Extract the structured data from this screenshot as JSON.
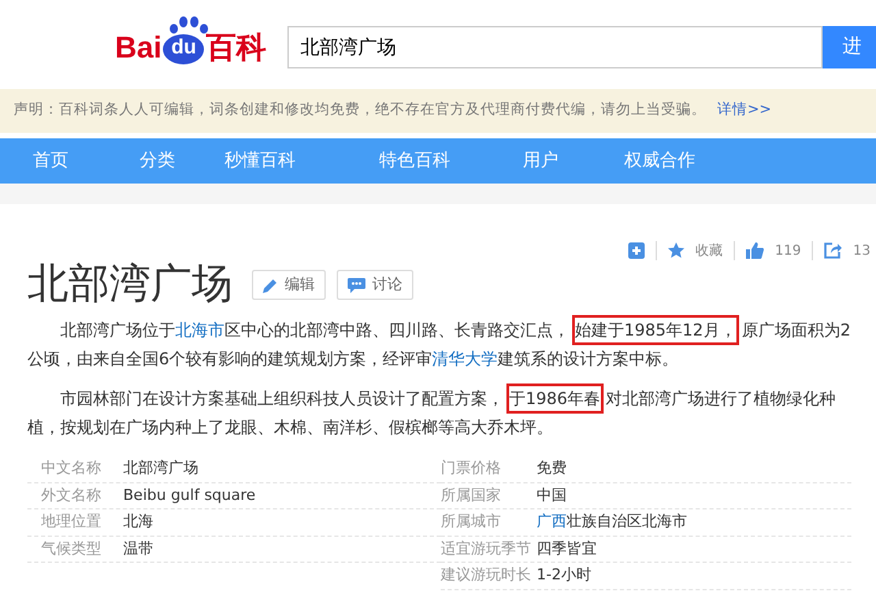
{
  "header": {
    "logo": {
      "left": "Bai",
      "paw": "du",
      "right": "百科"
    },
    "search": {
      "value": "北部湾广场"
    },
    "search_button": "进"
  },
  "notice": {
    "text": "声明：百科词条人人可编辑，词条创建和修改均免费，绝不存在官方及代理商付费代编，请勿上当受骗。",
    "link": "详情>>"
  },
  "nav": [
    "首页",
    "分类",
    "秒懂百科",
    "特色百科",
    "用户",
    "权威合作"
  ],
  "actions": {
    "favorite": "收藏",
    "likes": "119",
    "shares": "13"
  },
  "title": "北部湾广场",
  "title_buttons": [
    {
      "kind": "edit",
      "label": "编辑"
    },
    {
      "kind": "discuss",
      "label": "讨论"
    }
  ],
  "paragraphs": [
    [
      {
        "kind": "plain",
        "text": "北部湾广场位于"
      },
      {
        "kind": "link",
        "text": "北海市"
      },
      {
        "kind": "plain",
        "text": "区中心的北部湾中路、四川路、长青路交汇点，"
      },
      {
        "kind": "boxed",
        "text": "始建于1985年12月，"
      },
      {
        "kind": "plain",
        "text": "原广场面积为2公顷，由来自全国6个较有影响的建筑规划方案，经评审"
      },
      {
        "kind": "link",
        "text": "清华大学"
      },
      {
        "kind": "plain",
        "text": "建筑系的设计方案中标。"
      }
    ],
    [
      {
        "kind": "plain",
        "text": "市园林部门在设计方案基础上组织科技人员设计了配置方案，"
      },
      {
        "kind": "boxed",
        "text": "于1986年春"
      },
      {
        "kind": "plain",
        "text": "对北部湾广场进行了植物绿化种植，按规划在广场内种上了龙眼、木棉、南洋杉、假槟榔等高大乔木坪。"
      }
    ]
  ],
  "info_box": {
    "left": [
      {
        "label": "中文名称",
        "value": "北部湾广场"
      },
      {
        "label": "外文名称",
        "value": "Beibu gulf square"
      },
      {
        "label": "地理位置",
        "value": "北海"
      },
      {
        "label": "气候类型",
        "value": "温带"
      }
    ],
    "right": [
      {
        "label": "门票价格",
        "value": "免费"
      },
      {
        "label": "所属国家",
        "value": "中国"
      },
      {
        "label": "所属城市",
        "value": [
          {
            "kind": "link",
            "text": "广西"
          },
          {
            "kind": "plain",
            "text": "壮族自治区北海市"
          }
        ]
      },
      {
        "label": "适宜游玩季节",
        "value": "四季皆宜"
      },
      {
        "label": "建议游玩时长",
        "value": "1-2小时"
      }
    ]
  }
}
